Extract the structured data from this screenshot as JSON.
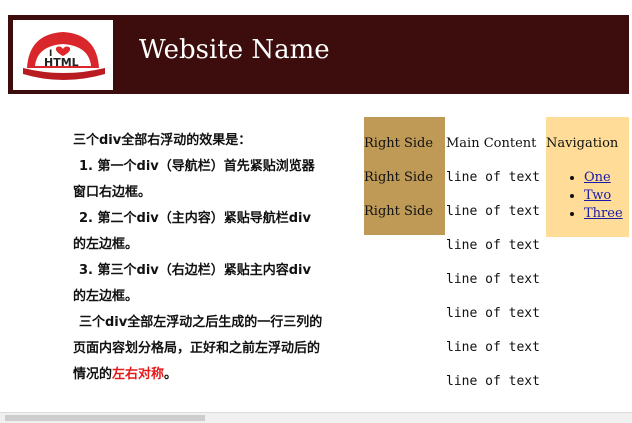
{
  "header": {
    "site_name": "Website Name",
    "logo_text_top": "I",
    "logo_text_bottom": "HTML",
    "background": "#3d0c0c"
  },
  "description": {
    "heading": "三个div全部右浮动的效果是：",
    "item1": "1. 第一个div（导航栏）首先紧贴浏览器窗口右边框。",
    "item2": "2. 第二个div（主内容）紧贴导航栏div的左边框。",
    "item3": "3. 第三个div（右边栏）紧贴主内容div的左边框。",
    "summary_prefix": "三个div全部左浮动之后生成的一行三列的页面内容划分格局，正好和之前左浮动后的情况的",
    "summary_highlight": "左右对称",
    "summary_suffix": "。"
  },
  "right_side": {
    "lines": [
      "Right Side",
      "Right Side",
      "Right Side"
    ],
    "background": "#bf9a57"
  },
  "main_content": {
    "title": "Main Content",
    "lines": [
      "line of text",
      "line of text",
      "line of text",
      "line of text",
      "line of text",
      "line of text",
      "line of text"
    ]
  },
  "navigation": {
    "title": "Navigation",
    "links": [
      "One",
      "Two",
      "Three"
    ],
    "background": "#ffdd99"
  }
}
